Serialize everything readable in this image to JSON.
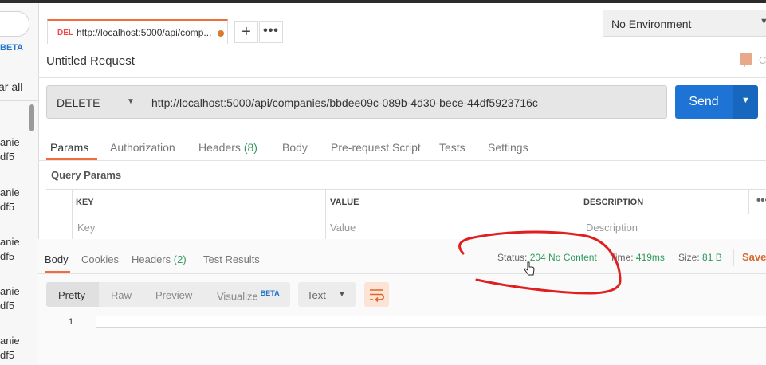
{
  "sidebar": {
    "beta": "BETA",
    "clear_all": "ar all",
    "items": [
      "anie\ndf5",
      "anie\ndf5",
      "anie\ndf5",
      "anie\ndf5",
      "anie\ndf5"
    ]
  },
  "tabs": [
    {
      "method": "DEL",
      "label": "http://localhost:5000/api/comp...",
      "unsaved": true
    }
  ],
  "tab_actions": {
    "add": "+",
    "more": "•••"
  },
  "environment": {
    "selected": "No Environment"
  },
  "request": {
    "title": "Untitled Request",
    "comments_label": "C",
    "method": "DELETE",
    "url": "http://localhost:5000/api/companies/bbdee09c-089b-4d30-bece-44df5923716c",
    "send_label": "Send"
  },
  "request_tabs": [
    {
      "label": "Params",
      "active": true
    },
    {
      "label": "Authorization"
    },
    {
      "label": "Headers",
      "count": "(8)"
    },
    {
      "label": "Body"
    },
    {
      "label": "Pre-request Script"
    },
    {
      "label": "Tests"
    },
    {
      "label": "Settings"
    }
  ],
  "query_params": {
    "title": "Query Params",
    "columns": [
      "KEY",
      "VALUE",
      "DESCRIPTION"
    ],
    "placeholders": [
      "Key",
      "Value",
      "Description"
    ],
    "more": "•••"
  },
  "response": {
    "tabs": [
      {
        "label": "Body",
        "active": true
      },
      {
        "label": "Cookies"
      },
      {
        "label": "Headers",
        "count": "(2)"
      },
      {
        "label": "Test Results"
      }
    ],
    "status_label": "Status:",
    "status_value": "204 No Content",
    "time_label": "Time:",
    "time_value": "419ms",
    "size_label": "Size:",
    "size_value": "81 B",
    "save": "Save",
    "formats": [
      "Pretty",
      "Raw",
      "Preview",
      "Visualize"
    ],
    "format_beta": "BETA",
    "language": "Text",
    "line_number": "1"
  },
  "colors": {
    "accent": "#f26b3a",
    "send": "#1d74d4",
    "status_ok": "#2e9a5b",
    "annotation": "#e02020"
  }
}
